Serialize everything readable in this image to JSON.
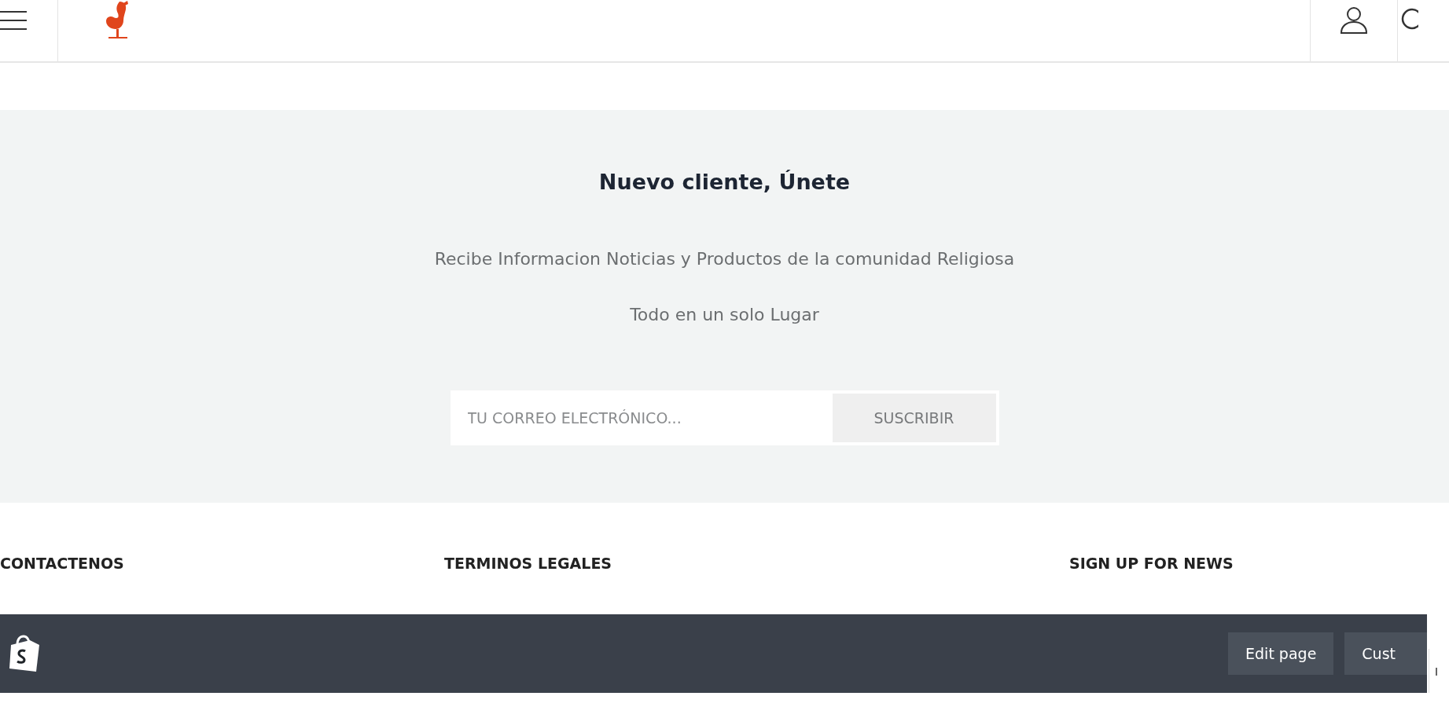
{
  "newsletter": {
    "title": "Nuevo cliente, Únete",
    "lines": [
      "Recibe Informacion Noticias y Productos de la comunidad Religiosa",
      "Todo en un solo Lugar"
    ],
    "email": {
      "placeholder": "TU CORREO ELECTRÓNICO..."
    },
    "button": "SUSCRIBIR"
  },
  "footer": {
    "headings": [
      "CONTACTENOS",
      "TERMINOS LEGALES",
      "SIGN UP FOR NEWS"
    ]
  },
  "admin_bar": {
    "buttons": [
      "Edit page",
      "Cust"
    ]
  }
}
